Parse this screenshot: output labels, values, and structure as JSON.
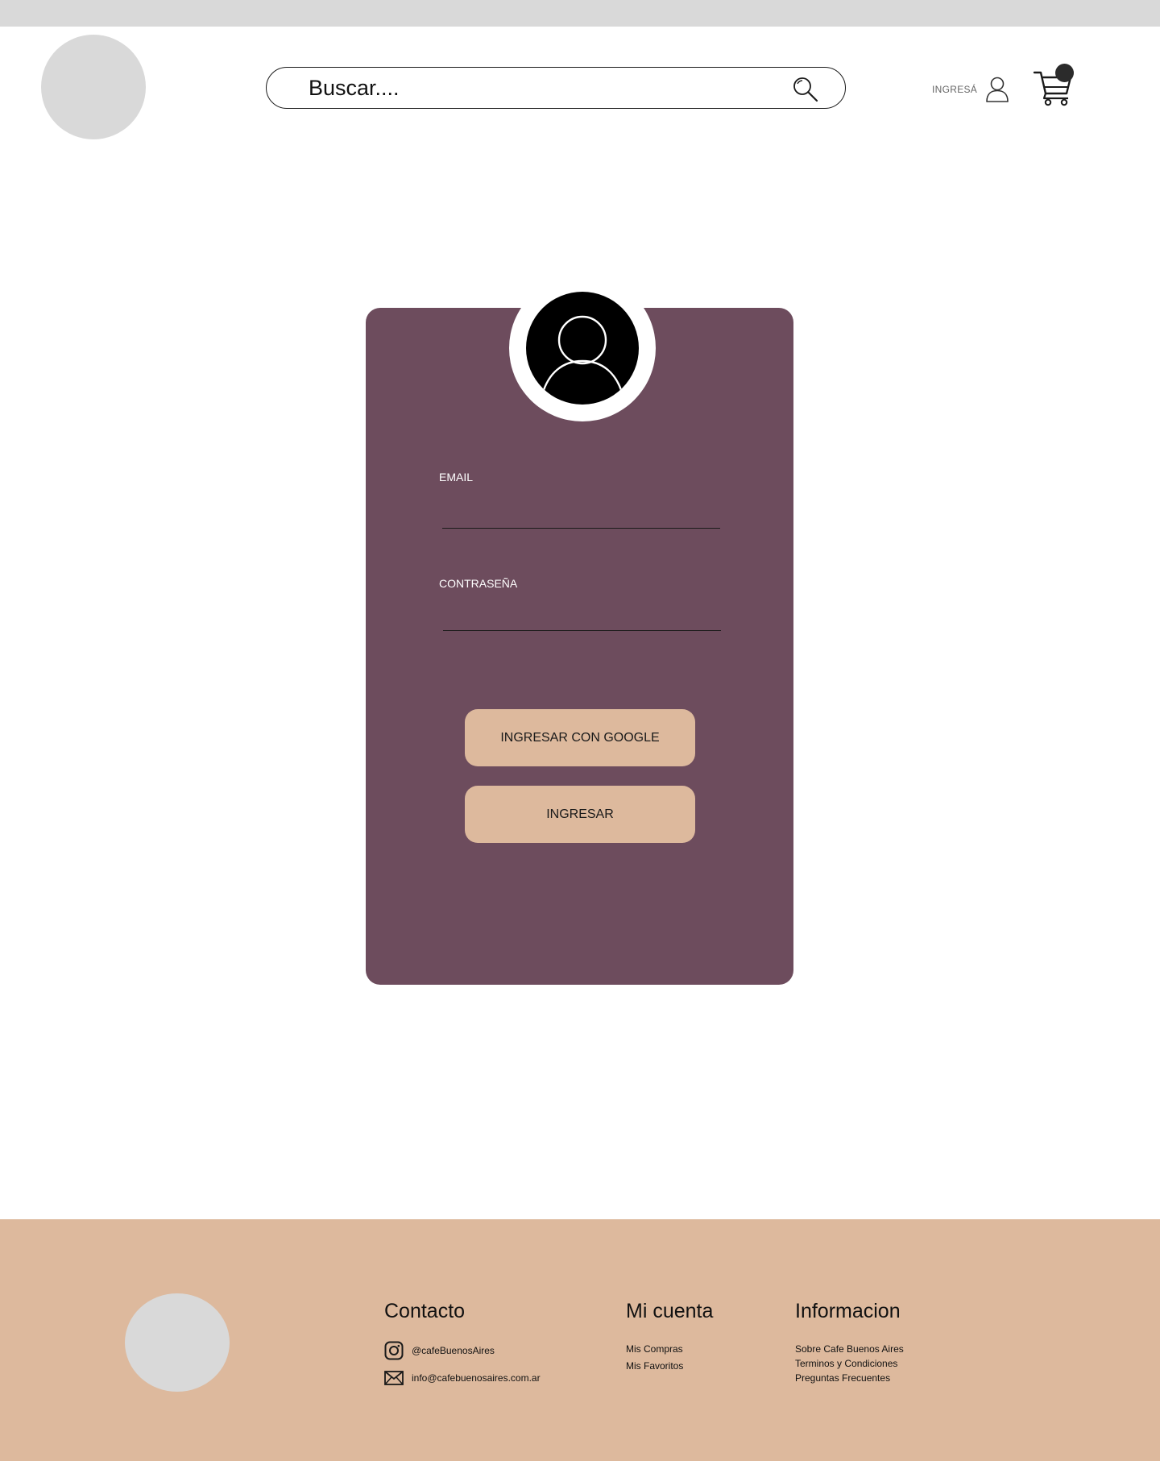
{
  "header": {
    "search_placeholder": "Buscar....",
    "login_label": "INGRESÁ"
  },
  "login_form": {
    "email_label": "EMAIL",
    "password_label": "CONTRASEÑA",
    "google_button": "INGRESAR CON GOOGLE",
    "submit_button": "INGRESAR"
  },
  "footer": {
    "contact": {
      "title": "Contacto",
      "instagram": "@cafeBuenosAires",
      "email": "info@cafebuenosaires.com.ar"
    },
    "account": {
      "title": "Mi cuenta",
      "links": [
        "Mis Compras",
        "Mis Favoritos"
      ]
    },
    "info": {
      "title": "Informacion",
      "links": [
        "Sobre Cafe Buenos Aires",
        "Terminos y Condiciones",
        "Preguntas Frecuentes"
      ]
    }
  },
  "colors": {
    "card": "#6d4c5d",
    "accent": "#ddb99d",
    "placeholder_gray": "#d9d9d9"
  },
  "icons": [
    "search-icon",
    "user-icon",
    "cart-icon",
    "avatar-icon",
    "instagram-icon",
    "mail-icon"
  ]
}
